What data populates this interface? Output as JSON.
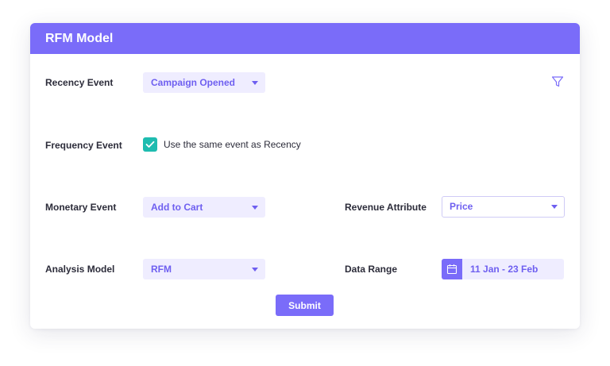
{
  "header": {
    "title": "RFM Model"
  },
  "form": {
    "recency": {
      "label": "Recency Event",
      "value": "Campaign Opened"
    },
    "frequency": {
      "label": "Frequency Event",
      "checkbox_label": "Use the same event as Recency",
      "checked": true
    },
    "monetary": {
      "label": "Monetary Event",
      "value": "Add to Cart"
    },
    "revenue": {
      "label": "Revenue Attribute",
      "value": "Price"
    },
    "analysis": {
      "label": "Analysis Model",
      "value": "RFM"
    },
    "date_range": {
      "label": "Data Range",
      "value": "11 Jan - 23 Feb"
    },
    "submit_label": "Submit"
  },
  "icons": {
    "filter": "filter-icon",
    "calendar": "calendar-icon",
    "check": "check-icon",
    "dropdown": "chevron-down-icon"
  },
  "colors": {
    "accent": "#7a6cf9",
    "accent_text": "#6e5ff0",
    "field_bg": "#efedff",
    "checkbox": "#1ebcb0"
  }
}
